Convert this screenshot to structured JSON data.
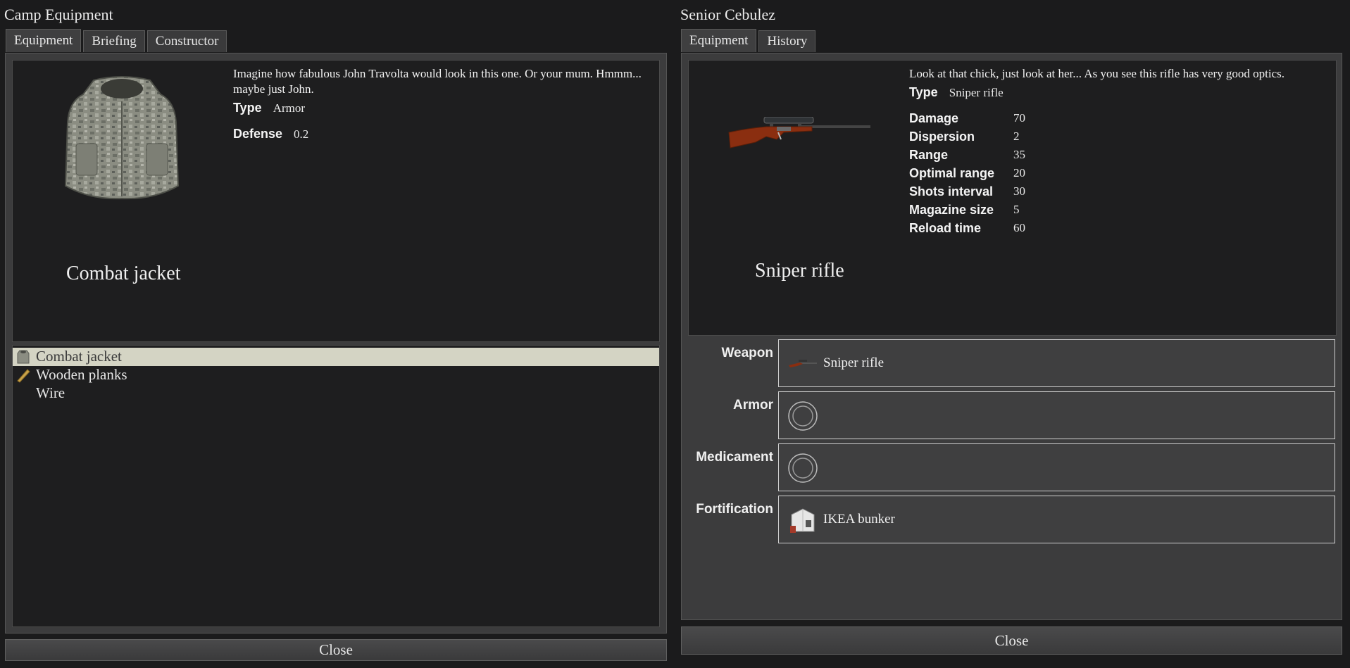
{
  "left": {
    "title": "Camp Equipment",
    "tabs": [
      "Equipment",
      "Briefing",
      "Constructor"
    ],
    "item": {
      "name": "Combat jacket",
      "description": "Imagine how fabulous John Travolta would look in this one. Or your mum. Hmmm... maybe just John.",
      "type_label": "Type",
      "type_value": "Armor",
      "defense_label": "Defense",
      "defense_value": "0.2"
    },
    "list": [
      {
        "label": "Combat jacket",
        "icon": "vest-icon",
        "selected": true
      },
      {
        "label": "Wooden planks",
        "icon": "plank-icon",
        "selected": false
      },
      {
        "label": "Wire",
        "icon": "",
        "selected": false
      }
    ],
    "close_label": "Close"
  },
  "right": {
    "title": "Senior Cebulez",
    "tabs": [
      "Equipment",
      "History"
    ],
    "item": {
      "name": "Sniper rifle",
      "description": "Look at that chick, just look at her... As you see this rifle has very good optics.",
      "type_label": "Type",
      "type_value": "Sniper rifle",
      "stats": [
        {
          "label": "Damage",
          "value": "70"
        },
        {
          "label": "Dispersion",
          "value": "2"
        },
        {
          "label": "Range",
          "value": "35"
        },
        {
          "label": "Optimal range",
          "value": "20"
        },
        {
          "label": "Shots interval",
          "value": "30"
        },
        {
          "label": "Magazine size",
          "value": "5"
        },
        {
          "label": "Reload time",
          "value": "60"
        }
      ]
    },
    "slots": [
      {
        "label": "Weapon",
        "value": "Sniper rifle",
        "icon": "rifle-icon"
      },
      {
        "label": "Armor",
        "value": "",
        "icon": "empty-slot-icon"
      },
      {
        "label": "Medicament",
        "value": "",
        "icon": "empty-slot-icon"
      },
      {
        "label": "Fortification",
        "value": "IKEA bunker",
        "icon": "bunker-icon"
      }
    ],
    "close_label": "Close"
  },
  "colors": {
    "background": "#1b1b1c",
    "panel": "#3c3c3d",
    "selected_row": "#d4d4c4",
    "rifle_stock": "#8a2e10"
  }
}
